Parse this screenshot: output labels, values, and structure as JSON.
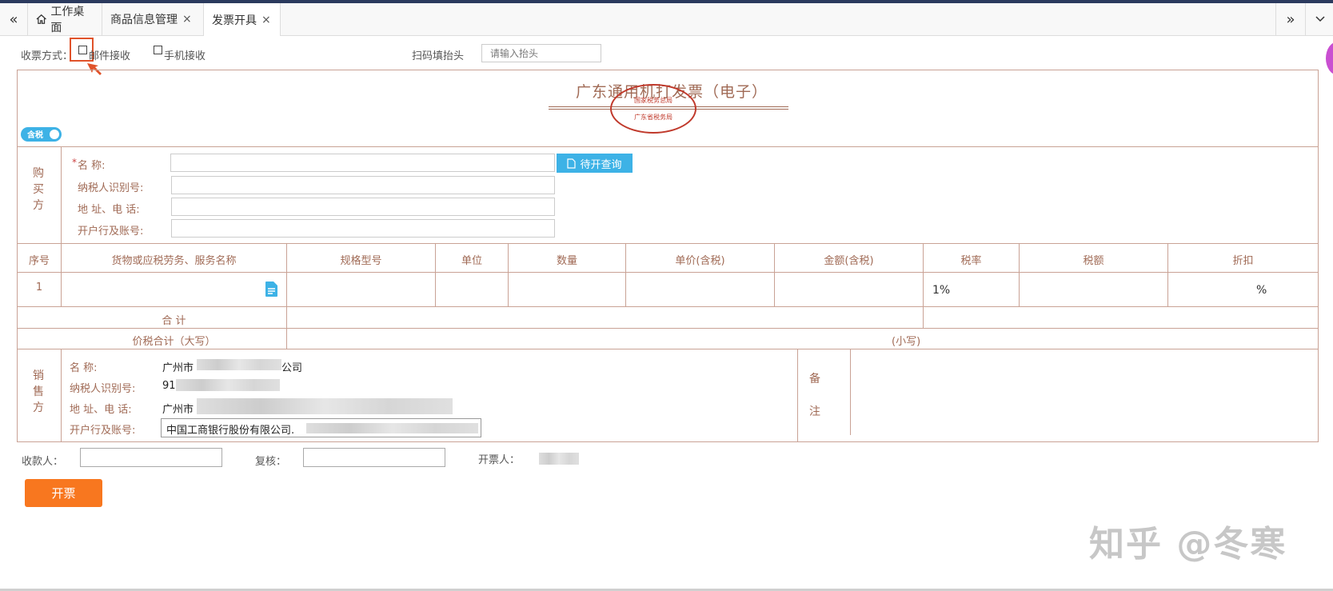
{
  "tabs": {
    "items": [
      {
        "label": "工作桌面",
        "closable": false
      },
      {
        "label": "商品信息管理",
        "closable": true
      },
      {
        "label": "发票开具",
        "closable": true
      }
    ],
    "close_glyph": "×",
    "prev_glyph": "«",
    "next_glyph": "»",
    "dropdown_glyph": "⌄"
  },
  "receipt": {
    "label": "收票方式：",
    "email_label": "邮件接收",
    "phone_label": "手机接收",
    "scan_label": "扫码填抬头",
    "scan_placeholder": "请输入抬头"
  },
  "invoice": {
    "title": "广东通用机打发票（电子）",
    "tax_toggle_label": "含税",
    "stamp_lines": [
      "国家税务总局",
      "广东省税务局"
    ]
  },
  "buyer": {
    "side_label": "购买方",
    "required_mark": "*",
    "name_label": "名          称:",
    "taxid_label": "纳税人识别号:",
    "address_label": "地 址、电 话:",
    "bank_label": "开户行及账号:",
    "query_button": "待开查询"
  },
  "table": {
    "headers": [
      "序号",
      "货物或应税劳务、服务名称",
      "规格型号",
      "单位",
      "数量",
      "单价(含税)",
      "金额(含税)",
      "税率",
      "税额",
      "折扣"
    ],
    "row": {
      "index": "1",
      "tax_rate": "1%",
      "discount_unit": "%"
    },
    "total_label": "合          计",
    "grand_total_label": "价税合计（大写）",
    "small_label": "(小写)"
  },
  "seller": {
    "side_label": "销售方",
    "name_label": "名          称:",
    "name_value": "广州市",
    "name_suffix": "公司",
    "taxid_label": "纳税人识别号:",
    "taxid_value": "91",
    "address_label": "地 址、电 话:",
    "address_value": "广州市",
    "bank_label": "开户行及账号:",
    "bank_value": "中国工商银行股份有限公司."
  },
  "notes": {
    "label_top": "备",
    "label_bottom": "注"
  },
  "footer": {
    "payee_label": "收款人：",
    "reviewer_label": "复核：",
    "drawer_label": "开票人：",
    "submit_button": "开票"
  },
  "watermark": {
    "text": "知乎 @冬寒"
  },
  "colors": {
    "accent_orange": "#f8771f",
    "invoice_brown": "#a06a55",
    "toggle_blue": "#3db2e6",
    "stamp_red": "#c0392b"
  }
}
